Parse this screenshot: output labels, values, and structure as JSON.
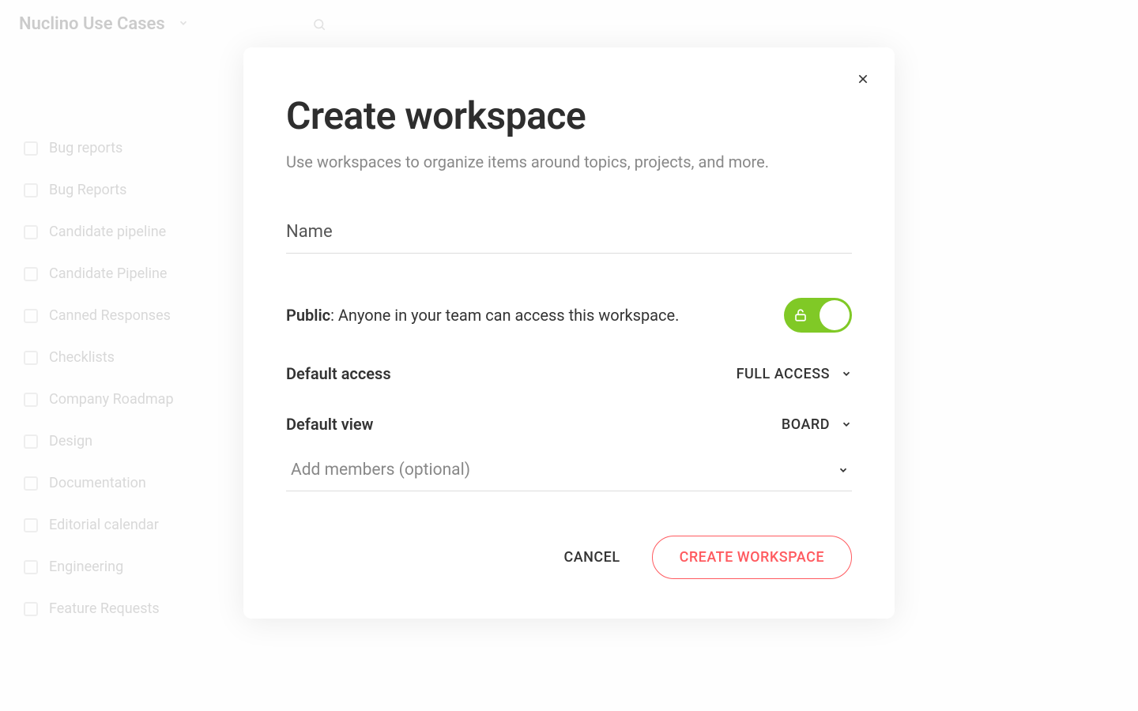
{
  "background": {
    "workspace_title": "Nuclino Use Cases",
    "sidebar_items": [
      "Bug reports",
      "Bug Reports",
      "Candidate pipeline",
      "Candidate Pipeline",
      "Canned Responses",
      "Checklists",
      "Company Roadmap",
      "Design",
      "Documentation",
      "Editorial calendar",
      "Engineering",
      "Feature Requests"
    ]
  },
  "modal": {
    "title": "Create workspace",
    "subtitle": "Use workspaces to organize items around topics, projects, and more.",
    "name_placeholder": "Name",
    "public_label_bold": "Public",
    "public_label_rest": ": Anyone in your team can access this workspace.",
    "public_toggle_on": true,
    "default_access_label": "Default access",
    "default_access_value": "FULL ACCESS",
    "default_view_label": "Default view",
    "default_view_value": "BOARD",
    "members_placeholder": "Add members (optional)",
    "cancel_label": "CANCEL",
    "create_label": "CREATE WORKSPACE"
  }
}
